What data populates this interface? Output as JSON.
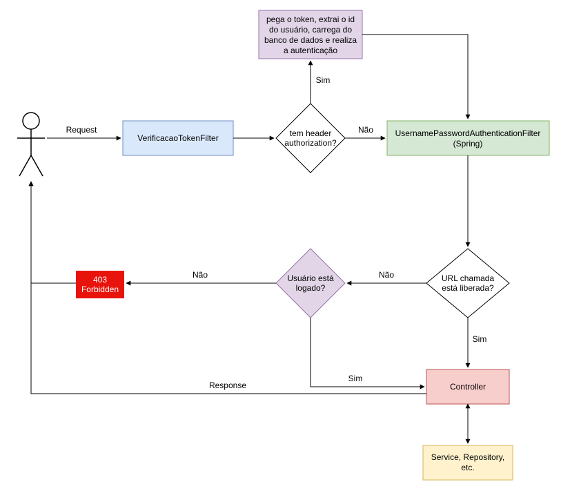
{
  "actor": {
    "name": "user-actor"
  },
  "edges": {
    "request": "Request",
    "response": "Response",
    "nao1": "Não",
    "sim1": "Sim",
    "nao2": "Não",
    "sim2": "Sim",
    "nao3": "Não",
    "sim3": "Sim"
  },
  "nodes": {
    "tokenFilter": "VerificacaoTokenFilter",
    "headerDecision": "tem header authorization?",
    "tokenProcess_l1": "pega o token, extrai o id",
    "tokenProcess_l2": "do usuário, carrega do",
    "tokenProcess_l3": "banco de dados e realiza",
    "tokenProcess_l4": "a autenticação",
    "springFilter_l1": "UsernamePasswordAuthenticationFilter",
    "springFilter_l2": "(Spring)",
    "urlDecision_l1": "URL chamada",
    "urlDecision_l2": "está liberada?",
    "loggedDecision_l1": "Usuário está",
    "loggedDecision_l2": "logado?",
    "forbidden_l1": "403",
    "forbidden_l2": "Forbidden",
    "controller": "Controller",
    "service_l1": "Service, Repository,",
    "service_l2": "etc."
  },
  "colors": {
    "blueFill": "#dae8fc",
    "blueStroke": "#6c8ebf",
    "purpleFill": "#e1d5e7",
    "purpleStroke": "#9673a6",
    "greenFill": "#d5e8d4",
    "greenStroke": "#82b366",
    "redFill": "#e8140c",
    "pinkFill": "#f8cecc",
    "pinkStroke": "#b85450",
    "yellowFill": "#fff2cc",
    "yellowStroke": "#d6b656",
    "black": "#000000",
    "white": "#ffffff"
  }
}
